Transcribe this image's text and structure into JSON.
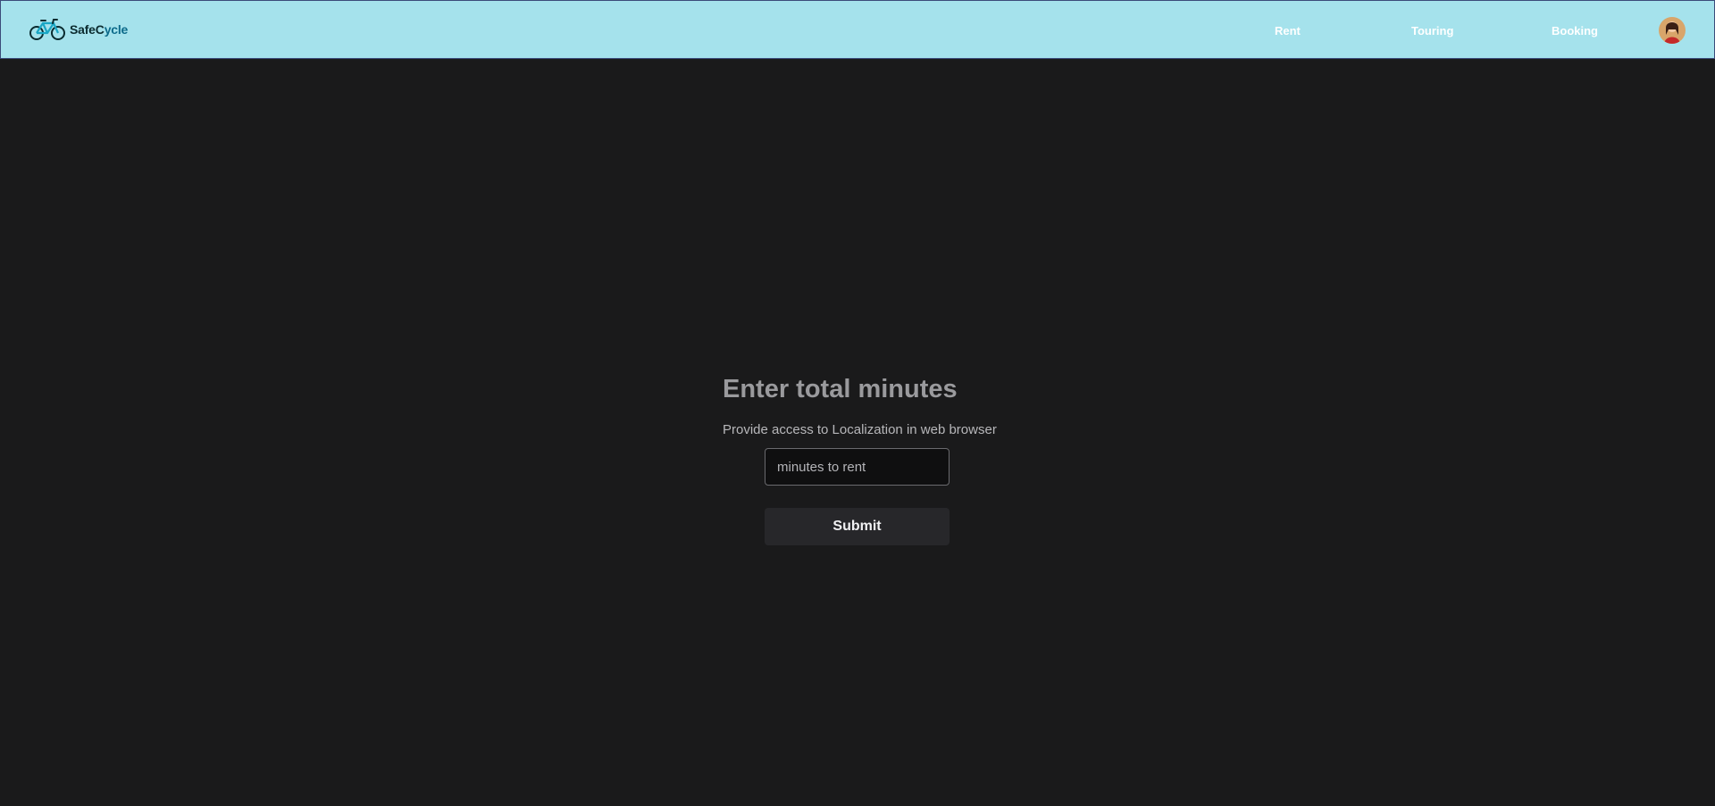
{
  "brand": {
    "name_prefix": "SafeC",
    "name_suffix": "ycle",
    "logo_icon": "bicycle-icon"
  },
  "nav": {
    "links": [
      {
        "label": "Rent"
      },
      {
        "label": "Touring"
      },
      {
        "label": "Booking"
      }
    ],
    "avatar_icon": "user-avatar"
  },
  "form": {
    "title": "Enter total minutes",
    "subtitle": "Provide access to Localization in web browser",
    "input_placeholder": "minutes to rent",
    "submit_label": "Submit"
  },
  "colors": {
    "navbar_bg": "#a5e2ec",
    "page_bg": "#1a1a1b",
    "brand_accent": "#0c6a8a"
  }
}
